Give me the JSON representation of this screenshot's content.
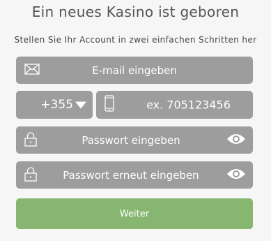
{
  "header": {
    "title": "Ein neues Kasino ist geboren",
    "subtitle": "Stellen Sie Ihr Account in zwei einfachen Schritten her"
  },
  "form": {
    "email": {
      "placeholder": "E-mail eingeben",
      "icon": "envelope-icon"
    },
    "phone_prefix": {
      "value": "+355",
      "icon": "caret-down-icon"
    },
    "phone": {
      "placeholder": "ex. 705123456",
      "icon": "mobile-phone-icon"
    },
    "password": {
      "placeholder": "Passwort eingeben",
      "icon": "lock-icon",
      "toggle_icon": "eye-icon"
    },
    "password_confirm": {
      "placeholder": "Passwort erneut eingeben",
      "icon": "lock-icon",
      "toggle_icon": "eye-icon"
    },
    "submit_label": "Weiter"
  },
  "colors": {
    "background": "#f6f6f6",
    "field": "#9d9d9d",
    "submit": "#86b66f",
    "text_light": "#ffffff",
    "title": "#555555"
  }
}
